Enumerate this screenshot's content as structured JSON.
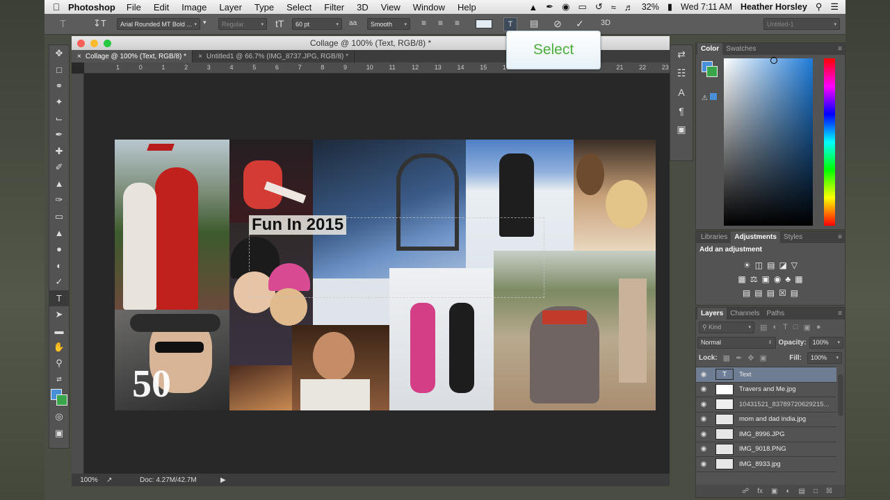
{
  "menubar": {
    "app": "Photoshop",
    "items": [
      "File",
      "Edit",
      "Image",
      "Layer",
      "Type",
      "Select",
      "Filter",
      "3D",
      "View",
      "Window",
      "Help"
    ],
    "battery": "32%",
    "datetime": "Wed 7:11 AM",
    "user": "Heather Horsley"
  },
  "options": {
    "font_family": "Arial Rounded MT Bold ...",
    "font_style": "Regular",
    "font_size": "60 pt",
    "aa_label": "a",
    "antialias": "Smooth",
    "workspace": "Untitled-1"
  },
  "tooltip": {
    "text": "Select"
  },
  "document": {
    "window_title": "Collage @ 100% (Text, RGB/8) *",
    "tabs": [
      {
        "label": "Collage @ 100% (Text, RGB/8) *",
        "active": true
      },
      {
        "label": "Untitled1 @ 66.7% (IMG_8737.JPG, RGB/8) *",
        "active": false
      }
    ],
    "ruler_labels": [
      "1",
      "0",
      "1",
      "2",
      "3",
      "4",
      "5",
      "6",
      "7",
      "8",
      "9",
      "10",
      "11",
      "12",
      "13",
      "14",
      "15",
      "16",
      "17",
      "18",
      "19",
      "20",
      "21",
      "22",
      "23",
      "24"
    ],
    "canvas_text": "Fun In 2015",
    "canvas_number": "50",
    "zoom": "100%",
    "doc_size": "Doc: 4.27M/42.7M"
  },
  "color_panel": {
    "tabs": [
      "Color",
      "Swatches"
    ],
    "fg": "#4a90d9",
    "bg": "#3aa64c"
  },
  "adjustments_panel": {
    "tabs": [
      "Libraries",
      "Adjustments",
      "Styles"
    ],
    "heading": "Add an adjustment"
  },
  "layers_panel": {
    "tabs": [
      "Layers",
      "Channels",
      "Paths"
    ],
    "filter": "Kind",
    "blend_mode": "Normal",
    "opacity_label": "Opacity:",
    "opacity": "100%",
    "lock_label": "Lock:",
    "fill_label": "Fill:",
    "fill": "100%",
    "layers": [
      {
        "name": "Text",
        "type": "text",
        "selected": true
      },
      {
        "name": "Travers and Me.jpg",
        "type": "image",
        "selected": false
      },
      {
        "name": "10431521_83789720629215...",
        "type": "image",
        "selected": false
      },
      {
        "name": "mom and dad india.jpg",
        "type": "image",
        "selected": false
      },
      {
        "name": "IMG_8996.JPG",
        "type": "image",
        "selected": false
      },
      {
        "name": "IMG_9018.PNG",
        "type": "image",
        "selected": false
      },
      {
        "name": "IMG_8933.jpg",
        "type": "image",
        "selected": false
      }
    ]
  }
}
